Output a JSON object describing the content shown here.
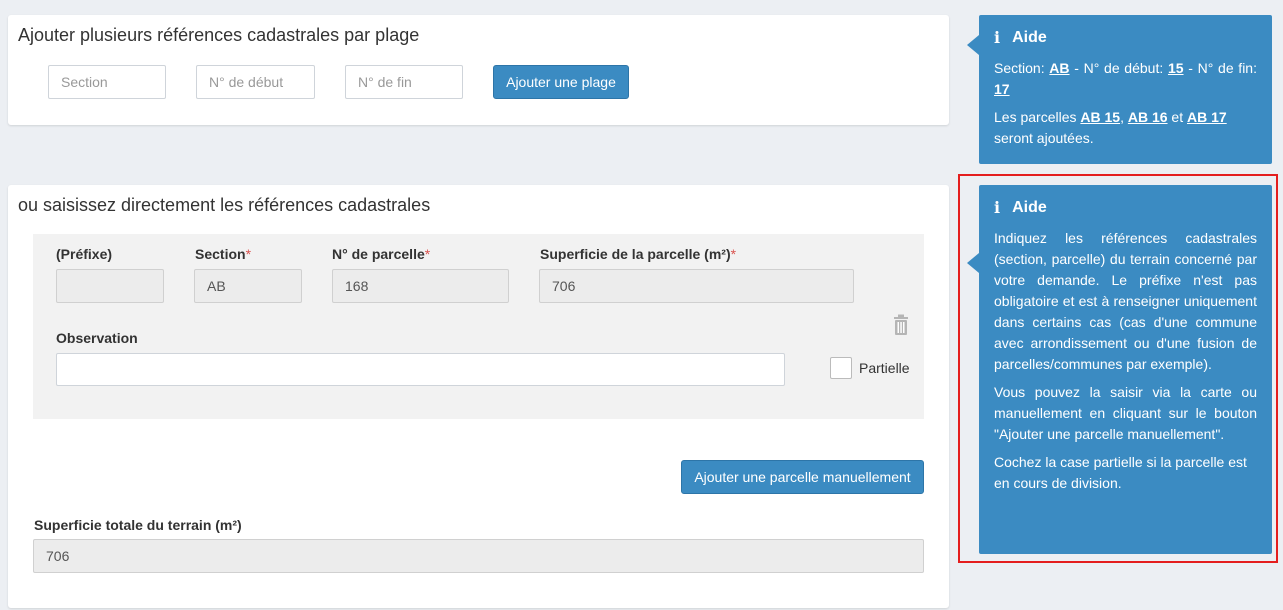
{
  "plage": {
    "title": "Ajouter plusieurs références cadastrales par plage",
    "section_placeholder": "Section",
    "debut_placeholder": "N° de début",
    "fin_placeholder": "N° de fin",
    "add_button": "Ajouter une plage"
  },
  "direct": {
    "title": "ou saisissez directement les références cadastrales",
    "prefixe_label": "(Préfixe)",
    "section_label": "Section",
    "parcelle_label": "N° de parcelle",
    "superficie_label": "Superficie de la parcelle (m²)",
    "required_mark": "*",
    "prefixe_value": "",
    "section_value": "AB",
    "parcelle_value": "168",
    "superficie_value": "706",
    "observation_label": "Observation",
    "observation_value": "",
    "partielle_label": "Partielle",
    "add_manual_button": "Ajouter une parcelle manuellement",
    "total_label": "Superficie totale du terrain (m²)",
    "total_value": "706"
  },
  "aide1": {
    "title": "Aide",
    "line1_a": "Section: ",
    "line1_b": "AB",
    "line1_c": " - N° de début: ",
    "line1_d": "15",
    "line1_e": " - N° de fin: ",
    "line1_f": "17",
    "line2_a": "Les parcelles ",
    "line2_b": "AB 15",
    "line2_c": ", ",
    "line2_d": "AB 16",
    "line2_e": " et ",
    "line2_f": "AB 17",
    "line2_g": " seront ajoutées."
  },
  "aide2": {
    "title": "Aide",
    "p1": "Indiquez les références cadastrales (section, parcelle) du terrain concerné par votre demande. Le préfixe n'est pas obligatoire et est à renseigner uniquement dans certains cas (cas d'une commune avec arrondissement ou d'une fusion de parcelles/communes par exemple).",
    "p2": "Vous pouvez la saisir via la carte ou manuellement en cliquant sur le bouton \"Ajouter une parcelle manuellement\".",
    "p3": "Cochez la case partielle si la parcelle est en cours de division."
  },
  "icons": {
    "info": "info-icon",
    "trash": "trash-icon"
  },
  "colors": {
    "accent": "#3b8bc2",
    "required": "#d9534f",
    "highlight": "#e41e1e"
  }
}
